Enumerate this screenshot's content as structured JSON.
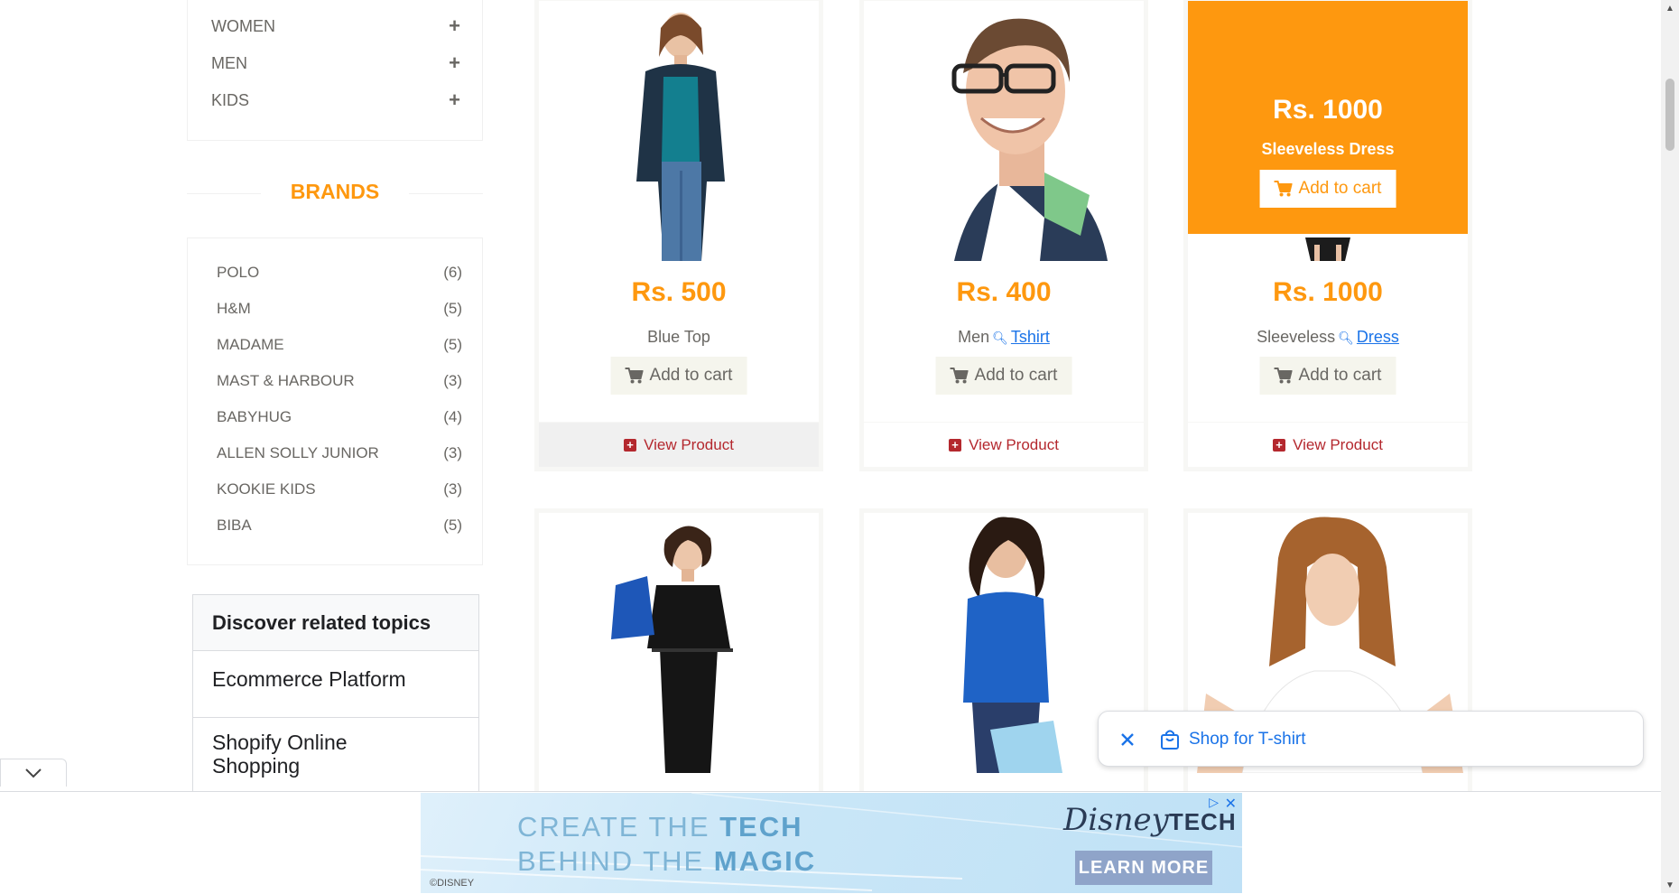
{
  "sidebar": {
    "categories": [
      {
        "label": "WOMEN",
        "icon": "plus-icon"
      },
      {
        "label": "MEN",
        "icon": "plus-icon"
      },
      {
        "label": "KIDS",
        "icon": "plus-icon"
      }
    ],
    "brands_title": "BRANDS",
    "brands": [
      {
        "name": "POLO",
        "count": "(6)"
      },
      {
        "name": "H&M",
        "count": "(5)"
      },
      {
        "name": "MADAME",
        "count": "(5)"
      },
      {
        "name": "MAST & HARBOUR",
        "count": "(3)"
      },
      {
        "name": "BABYHUG",
        "count": "(4)"
      },
      {
        "name": "ALLEN SOLLY JUNIOR",
        "count": "(3)"
      },
      {
        "name": "KOOKIE KIDS",
        "count": "(3)"
      },
      {
        "name": "BIBA",
        "count": "(5)"
      }
    ]
  },
  "related": {
    "title": "Discover related topics",
    "items": [
      "Ecommerce Platform",
      "Shopify Online Shopping"
    ]
  },
  "products": [
    {
      "price": "Rs. 500",
      "name": "Blue Top",
      "name_prefix": "",
      "keyword": "",
      "add_to_cart": "Add to cart",
      "view_product": "View Product"
    },
    {
      "price": "Rs. 400",
      "name": "",
      "name_prefix": "Men",
      "keyword": "Tshirt",
      "add_to_cart": "Add to cart",
      "view_product": "View Product"
    },
    {
      "price": "Rs. 1000",
      "name": "",
      "name_prefix": "Sleeveless",
      "keyword": "Dress",
      "add_to_cart": "Add to cart",
      "view_product": "View Product",
      "overlay": {
        "price": "Rs. 1000",
        "name": "Sleeveless Dress",
        "add_to_cart": "Add to cart"
      }
    }
  ],
  "shop_chip": {
    "label": "Shop for T-shirt"
  },
  "ad": {
    "line1": "CREATE THE ",
    "line1_bold": "TECH",
    "line2": "BEHIND THE ",
    "line2_bold": "MAGIC",
    "brand": "Disney",
    "brand_suffix": "TECH",
    "cta": "LEARN MORE",
    "copyright": "©DISNEY"
  },
  "colors": {
    "accent": "#FE980F",
    "link": "#1a73e8",
    "view_product": "#B4282E"
  }
}
